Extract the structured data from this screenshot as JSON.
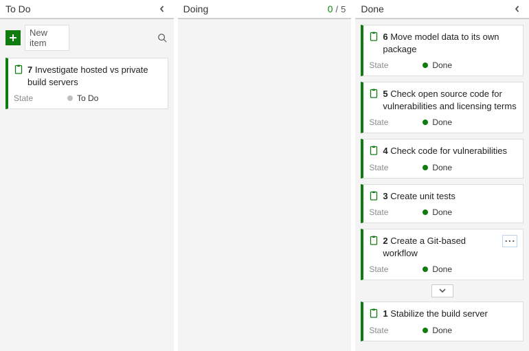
{
  "columns": {
    "todo": {
      "title": "To Do",
      "collapsible": true
    },
    "doing": {
      "title": "Doing",
      "wip_current": "0",
      "wip_limit": "5"
    },
    "done": {
      "title": "Done",
      "collapsible": true
    }
  },
  "new_item": {
    "label": "New item"
  },
  "state_field_label": "State",
  "state_values": {
    "todo": "To Do",
    "done": "Done"
  },
  "todo_cards": [
    {
      "id": "7",
      "title": "Investigate hosted vs private build servers",
      "state": "todo"
    }
  ],
  "done_cards": [
    {
      "id": "6",
      "title": "Move model data to its own package",
      "state": "done"
    },
    {
      "id": "5",
      "title": "Check open source code for vulnerabilities and licensing terms",
      "state": "done"
    },
    {
      "id": "4",
      "title": "Check code for vulnerabilities",
      "state": "done"
    },
    {
      "id": "3",
      "title": "Create unit tests",
      "state": "done"
    },
    {
      "id": "2",
      "title": "Create a Git-based workflow",
      "state": "done",
      "show_more": true,
      "show_expand": true
    },
    {
      "id": "1",
      "title": "Stabilize the build server",
      "state": "done"
    }
  ]
}
